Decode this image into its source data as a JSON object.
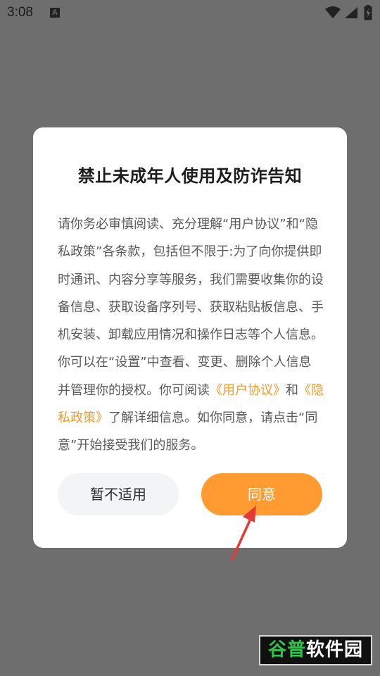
{
  "status_bar": {
    "time": "3:08",
    "notification_letter": "A",
    "icons": [
      "wifi-icon",
      "signal-icon",
      "battery-charging-icon"
    ]
  },
  "dialog": {
    "title": "禁止未成年人使用及防诈告知",
    "body": {
      "part1": "请你务必审慎阅读、充分理解“用户协议”和“隐私政策”各条款，包括但不限于:为了向你提供即时通讯、内容分享等服务，我们需要收集你的设备信息、获取设备序列号、获取粘贴板信息、手机安装、卸载应用情况和操作日志等个人信息。你可以在“设置”中查看、变更、删除个人信息并管理你的授权。你可阅读",
      "link_user_agreement": "《用户协议》",
      "part2": "和",
      "link_privacy_policy": "《隐私政策》",
      "part3": "了解详细信息。如你同意，请点击“同意”开始接受我们的服务。"
    },
    "decline_label": "暂不适用",
    "agree_label": "同意"
  },
  "watermark": {
    "part1": "谷普",
    "part2": "软件园"
  },
  "colors": {
    "overlay": "#6e6e6e",
    "accent": "#ff9b31",
    "link": "#f59a23",
    "annotation_arrow": "#e53935"
  }
}
